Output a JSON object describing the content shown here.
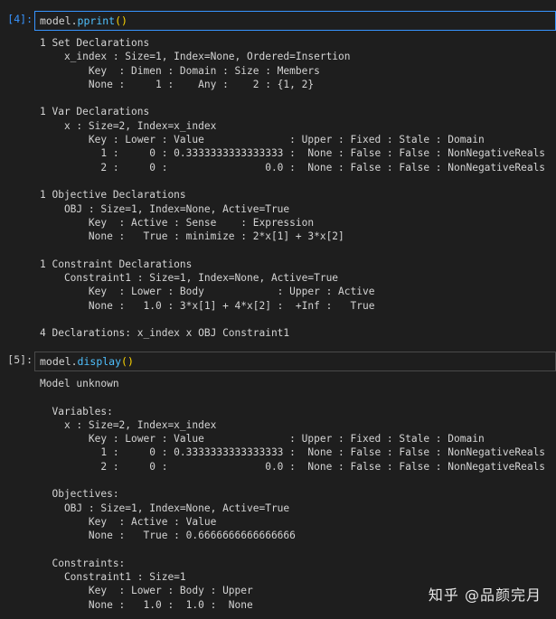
{
  "cells": [
    {
      "prompt": "[4]:",
      "code_prefix": "model.",
      "code_fn": "pprint",
      "code_paren": "()",
      "output": "1 Set Declarations\n    x_index : Size=1, Index=None, Ordered=Insertion\n        Key  : Dimen : Domain : Size : Members\n        None :     1 :    Any :    2 : {1, 2}\n\n1 Var Declarations\n    x : Size=2, Index=x_index\n        Key : Lower : Value              : Upper : Fixed : Stale : Domain\n          1 :     0 : 0.3333333333333333 :  None : False : False : NonNegativeReals\n          2 :     0 :                0.0 :  None : False : False : NonNegativeReals\n\n1 Objective Declarations\n    OBJ : Size=1, Index=None, Active=True\n        Key  : Active : Sense    : Expression\n        None :   True : minimize : 2*x[1] + 3*x[2]\n\n1 Constraint Declarations\n    Constraint1 : Size=1, Index=None, Active=True\n        Key  : Lower : Body            : Upper : Active\n        None :   1.0 : 3*x[1] + 4*x[2] :  +Inf :   True\n\n4 Declarations: x_index x OBJ Constraint1"
    },
    {
      "prompt": "[5]:",
      "code_prefix": "model.",
      "code_fn": "display",
      "code_paren": "()",
      "output": "Model unknown\n\n  Variables:\n    x : Size=2, Index=x_index\n        Key : Lower : Value              : Upper : Fixed : Stale : Domain\n          1 :     0 : 0.3333333333333333 :  None : False : False : NonNegativeReals\n          2 :     0 :                0.0 :  None : False : False : NonNegativeReals\n\n  Objectives:\n    OBJ : Size=1, Index=None, Active=True\n        Key  : Active : Value\n        None :   True : 0.6666666666666666\n\n  Constraints:\n    Constraint1 : Size=1\n        Key  : Lower : Body : Upper\n        None :   1.0 :  1.0 :  None"
    }
  ],
  "watermark": "知乎 @品颜完月"
}
